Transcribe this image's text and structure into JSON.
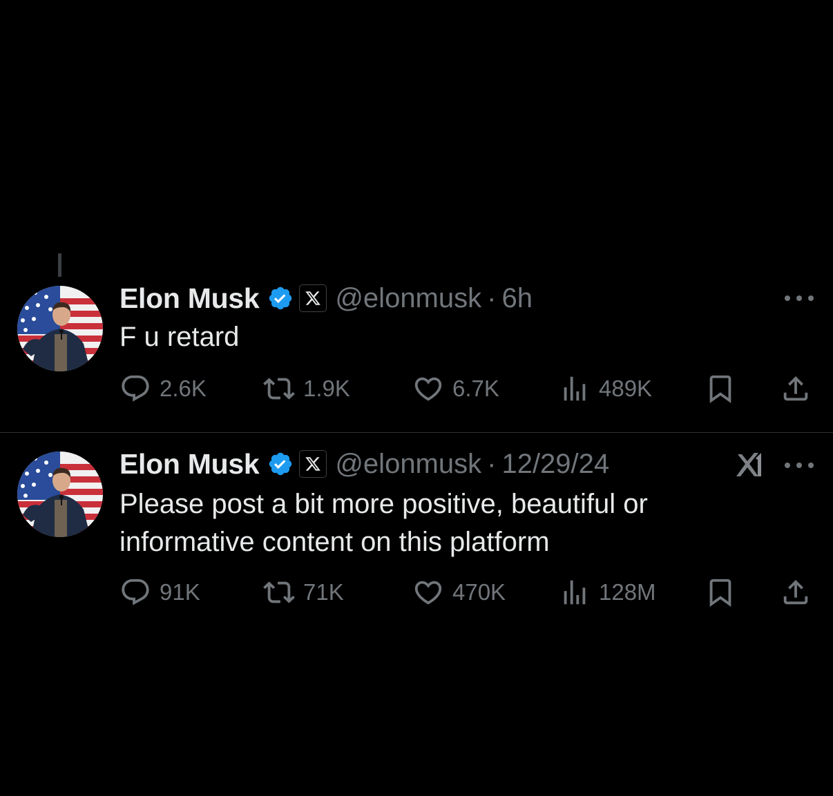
{
  "colors": {
    "background": "#000000",
    "primary_text": "#e7e9ea",
    "secondary_text": "#71767b",
    "divider": "#2f3336",
    "verified_badge": "#1d9bf0"
  },
  "tweets": [
    {
      "author": {
        "name": "Elon Musk",
        "handle": "@elonmusk",
        "verified_icon": "verified-badge-icon",
        "affiliate_icon": "x-logo-icon"
      },
      "separator": "·",
      "time": "6h",
      "text": "F u retard",
      "more_icon": "more-options-icon",
      "actions": {
        "reply": {
          "icon": "reply-icon",
          "count": "2.6K"
        },
        "repost": {
          "icon": "repost-icon",
          "count": "1.9K"
        },
        "like": {
          "icon": "heart-icon",
          "count": "6.7K"
        },
        "views": {
          "icon": "views-icon",
          "count": "489K"
        },
        "bookmark": {
          "icon": "bookmark-icon"
        },
        "share": {
          "icon": "share-icon"
        }
      }
    },
    {
      "author": {
        "name": "Elon Musk",
        "handle": "@elonmusk",
        "verified_icon": "verified-badge-icon",
        "affiliate_icon": "x-logo-icon"
      },
      "separator": "·",
      "time": "12/29/24",
      "text": "Please post a bit more positive, beautiful or informative content on this platform",
      "grok_icon": "grok-icon",
      "more_icon": "more-options-icon",
      "actions": {
        "reply": {
          "icon": "reply-icon",
          "count": "91K"
        },
        "repost": {
          "icon": "repost-icon",
          "count": "71K"
        },
        "like": {
          "icon": "heart-icon",
          "count": "470K"
        },
        "views": {
          "icon": "views-icon",
          "count": "128M"
        },
        "bookmark": {
          "icon": "bookmark-icon"
        },
        "share": {
          "icon": "share-icon"
        }
      }
    }
  ]
}
